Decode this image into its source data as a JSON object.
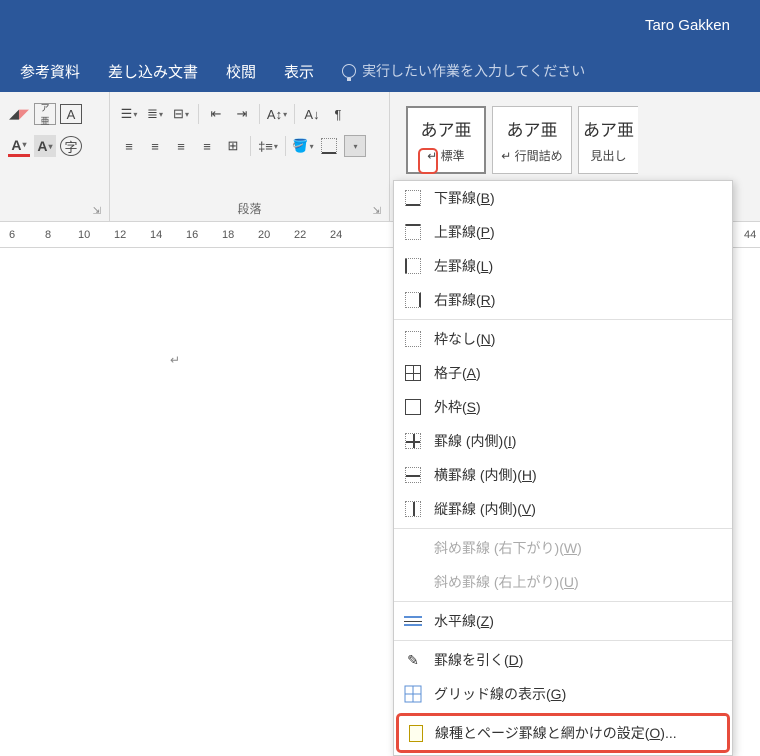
{
  "user_name": "Taro Gakken",
  "tabs": {
    "ref": "参考資料",
    "mail": "差し込み文書",
    "review": "校閲",
    "view": "表示"
  },
  "tell_me": "実行したい作業を入力してください",
  "group_paragraph": "段落",
  "styles": {
    "s1_sample": "あア亜",
    "s1_name": "↵ 標準",
    "s2_sample": "あア亜",
    "s2_name": "↵ 行間詰め",
    "s3_sample": "あア亜",
    "s3_name": "見出し"
  },
  "ruler": [
    "6",
    "8",
    "10",
    "12",
    "14",
    "16",
    "18",
    "20",
    "22",
    "24"
  ],
  "ruler_right": "44",
  "menu": {
    "bottom": "下罫線",
    "bottom_k": "B",
    "top": "上罫線",
    "top_k": "P",
    "left": "左罫線",
    "left_k": "L",
    "right": "右罫線",
    "right_k": "R",
    "none": "枠なし",
    "none_k": "N",
    "all": "格子",
    "all_k": "A",
    "out": "外枠",
    "out_k": "S",
    "in": "罫線 (内側)",
    "in_k": "I",
    "hin": "横罫線 (内側)",
    "hin_k": "H",
    "vin": "縦罫線 (内側)",
    "vin_k": "V",
    "diag1": "斜め罫線 (右下がり)",
    "diag1_k": "W",
    "diag2": "斜め罫線 (右上がり)",
    "diag2_k": "U",
    "hr": "水平線",
    "hr_k": "Z",
    "draw": "罫線を引く",
    "draw_k": "D",
    "grid": "グリッド線の表示",
    "grid_k": "G",
    "settings": "線種とページ罫線と網かけの設定",
    "settings_k": "O",
    "settings_suffix": "..."
  }
}
